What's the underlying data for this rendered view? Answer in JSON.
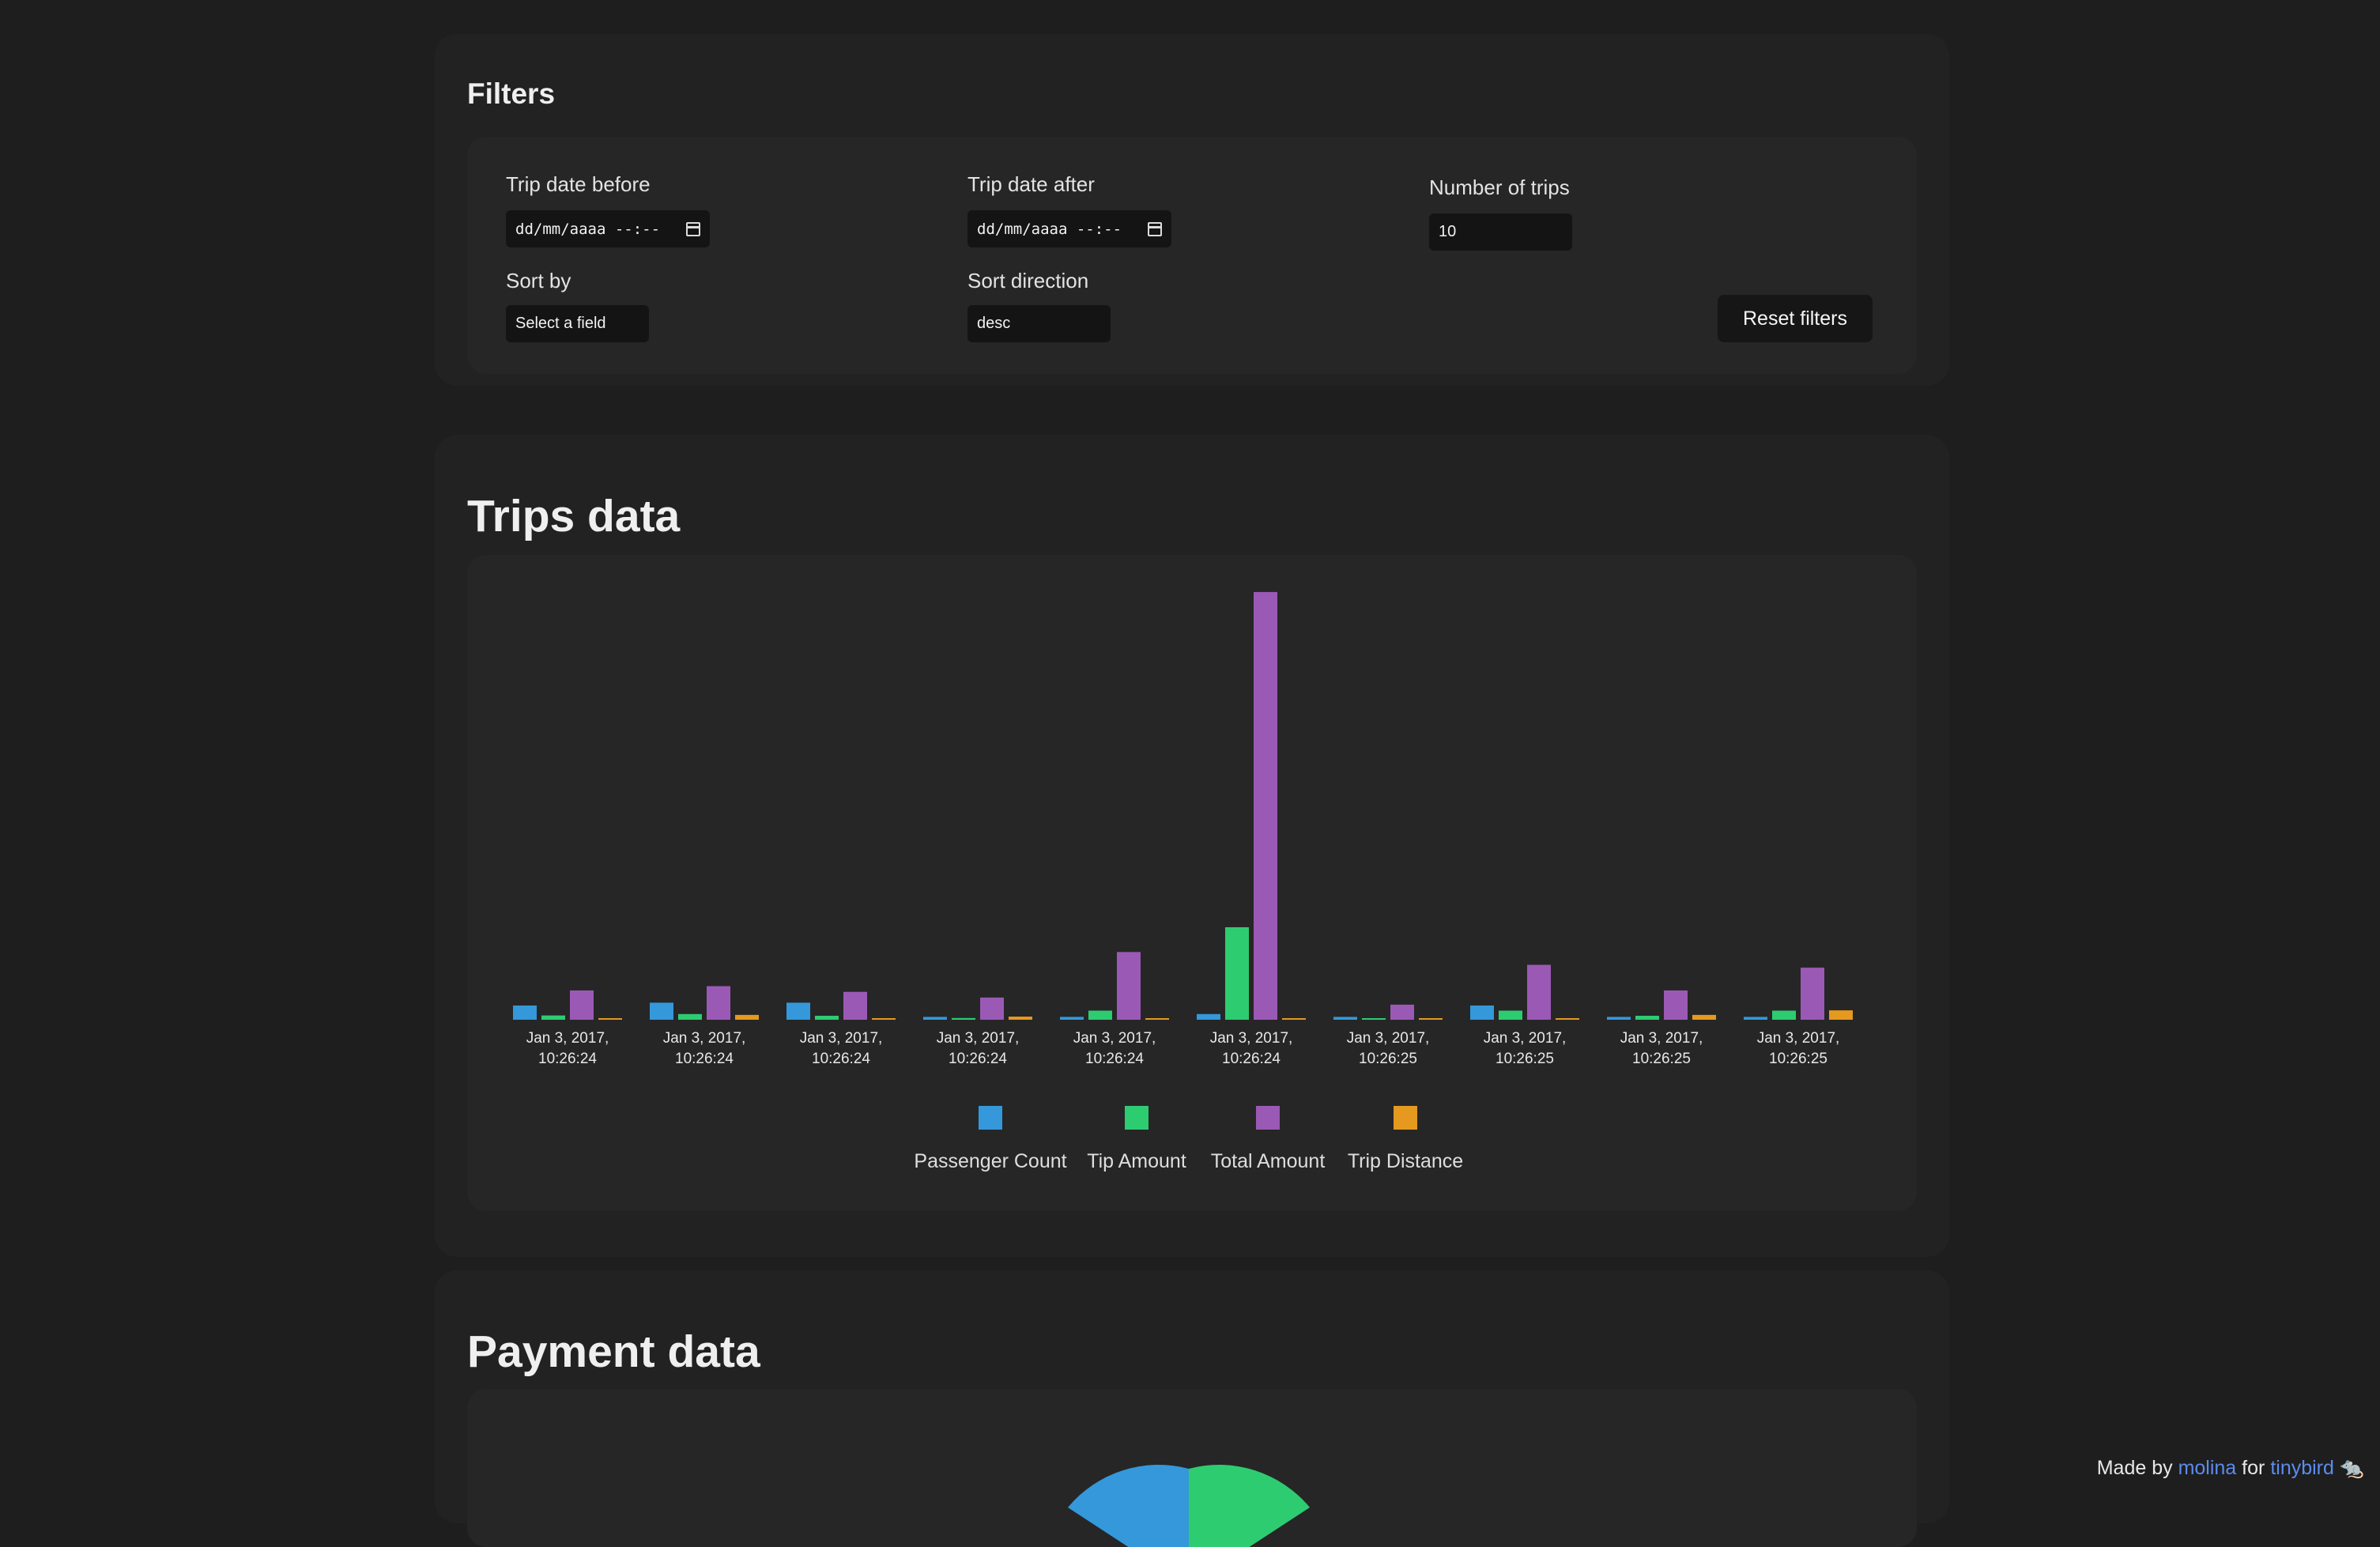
{
  "filters": {
    "title": "Filters",
    "trip_date_before": {
      "label": "Trip date before",
      "value": "dd/mm/aaaa --:--"
    },
    "trip_date_after": {
      "label": "Trip date after",
      "value": "dd/mm/aaaa --:--"
    },
    "number_of_trips": {
      "label": "Number of trips",
      "value": "10"
    },
    "sort_by": {
      "label": "Sort by",
      "value": "Select a field"
    },
    "sort_direction": {
      "label": "Sort direction",
      "value": "desc"
    },
    "reset_label": "Reset filters"
  },
  "trips": {
    "title": "Trips data"
  },
  "payment": {
    "title": "Payment data"
  },
  "footer": {
    "made_by": "Made by",
    "author": "molina",
    "for_text": "for",
    "brand": "tinybird",
    "brand_icon": "🐀"
  },
  "colors": {
    "passenger": "#3498db",
    "tip": "#2ecc71",
    "total": "#9b59b6",
    "distance": "#e5991f"
  },
  "chart_data": {
    "type": "bar",
    "title": "",
    "xlabel": "",
    "ylabel": "",
    "ylim": [
      0,
      150
    ],
    "legend_position": "bottom",
    "grid": false,
    "categories": [
      [
        "Jan 3, 2017,",
        "10:26:24"
      ],
      [
        "Jan 3, 2017,",
        "10:26:24"
      ],
      [
        "Jan 3, 2017,",
        "10:26:24"
      ],
      [
        "Jan 3, 2017,",
        "10:26:24"
      ],
      [
        "Jan 3, 2017,",
        "10:26:24"
      ],
      [
        "Jan 3, 2017,",
        "10:26:24"
      ],
      [
        "Jan 3, 2017,",
        "10:26:25"
      ],
      [
        "Jan 3, 2017,",
        "10:26:25"
      ],
      [
        "Jan 3, 2017,",
        "10:26:25"
      ],
      [
        "Jan 3, 2017,",
        "10:26:25"
      ]
    ],
    "series": [
      {
        "name": "Passenger Count",
        "color": "#3498db",
        "values": [
          5,
          6,
          6,
          1,
          1,
          2,
          1,
          5,
          1,
          1
        ]
      },
      {
        "name": "Tip Amount",
        "color": "#2ecc71",
        "values": [
          1.5,
          2,
          1.4,
          0.6,
          3.2,
          32.5,
          0.4,
          3.2,
          1.4,
          3.2
        ]
      },
      {
        "name": "Total Amount",
        "color": "#9b59b6",
        "values": [
          10.3,
          11.8,
          9.8,
          7.8,
          23.8,
          150.3,
          5.3,
          19.3,
          10.3,
          18.3
        ]
      },
      {
        "name": "Trip Distance",
        "color": "#e5991f",
        "values": [
          0.5,
          1.7,
          0.4,
          1.1,
          0.4,
          0.4,
          0.2,
          0.4,
          1.7,
          3.3
        ]
      }
    ]
  }
}
